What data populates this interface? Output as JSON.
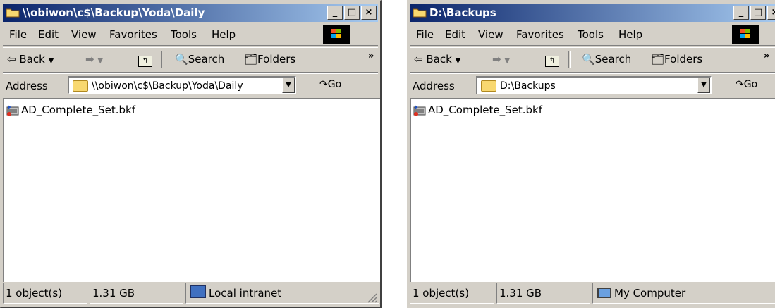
{
  "left": {
    "title": "\\\\obiwon\\c$\\Backup\\Yoda\\Daily",
    "menu": [
      "File",
      "Edit",
      "View",
      "Favorites",
      "Tools",
      "Help"
    ],
    "toolbar": {
      "back": "Back",
      "search": "Search",
      "folders": "Folders"
    },
    "address_label": "Address",
    "address_value": "\\\\obiwon\\c$\\Backup\\Yoda\\Daily",
    "go": "Go",
    "file_name": "AD_Complete_Set.bkf",
    "status": {
      "objects": "1 object(s)",
      "size": "1.31 GB",
      "zone": "Local intranet"
    }
  },
  "right": {
    "title": "D:\\Backups",
    "menu": [
      "File",
      "Edit",
      "View",
      "Favorites",
      "Tools",
      "Help"
    ],
    "toolbar": {
      "back": "Back",
      "search": "Search",
      "folders": "Folders"
    },
    "address_label": "Address",
    "address_value": "D:\\Backups",
    "go": "Go",
    "file_name": "AD_Complete_Set.bkf",
    "status": {
      "objects": "1 object(s)",
      "size": "1.31 GB",
      "zone": "My Computer"
    }
  },
  "colors": {
    "title_start": "#0a246a",
    "title_end": "#a6caf0",
    "chrome": "#d4d0c8"
  }
}
